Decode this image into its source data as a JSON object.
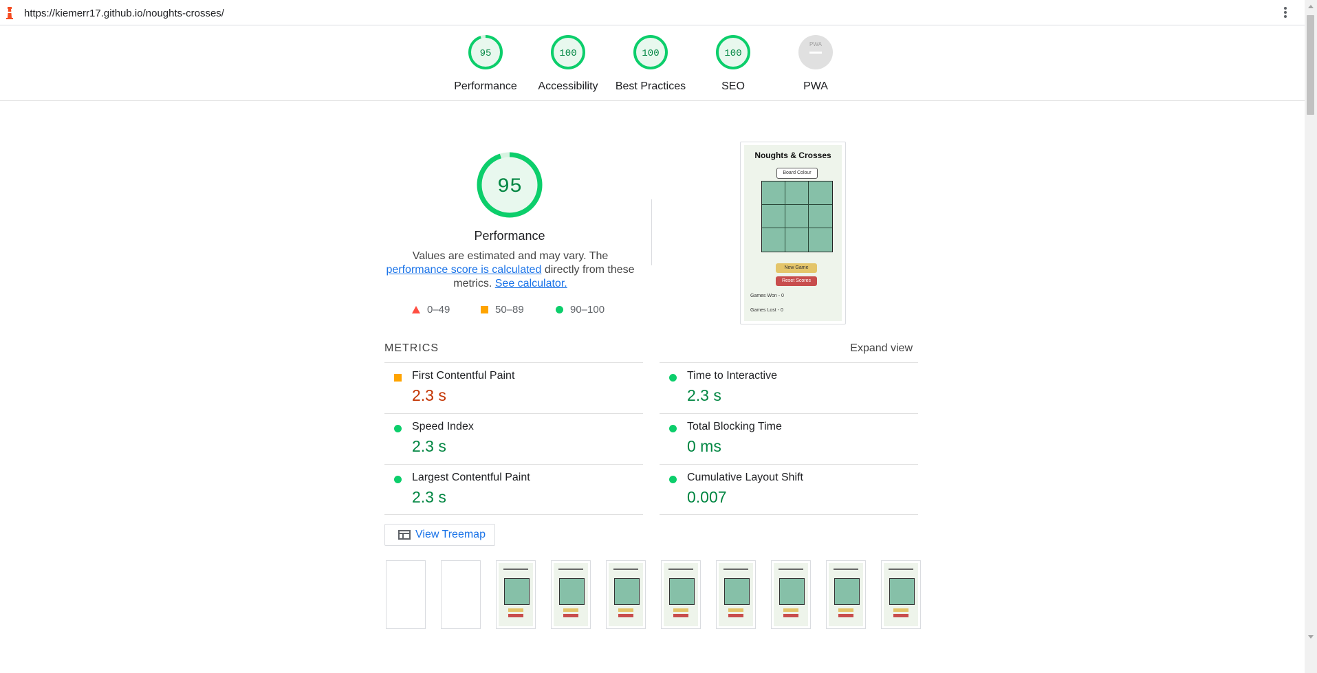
{
  "browser": {
    "url": "https://kiemerr17.github.io/noughts-crosses/"
  },
  "score_categories": [
    {
      "label": "Performance",
      "score": "95",
      "color": "#0cce6b"
    },
    {
      "label": "Accessibility",
      "score": "100",
      "color": "#0cce6b"
    },
    {
      "label": "Best Practices",
      "score": "100",
      "color": "#0cce6b"
    },
    {
      "label": "SEO",
      "score": "100",
      "color": "#0cce6b"
    },
    {
      "label": "PWA",
      "score": "",
      "badge_text": "PWA",
      "color": "#9e9e9e"
    }
  ],
  "performance": {
    "score": "95",
    "score_fraction": 0.95,
    "title": "Performance",
    "desc_1": "Values are estimated and may vary. The",
    "desc_link_1": "performance score is calculated",
    "desc_2": "directly from these metrics.",
    "desc_link_2": "See calculator."
  },
  "legend": [
    {
      "label": "0–49",
      "shape": "triangle",
      "color": "#ff4e42"
    },
    {
      "label": "50–89",
      "shape": "square",
      "color": "#ffa400"
    },
    {
      "label": "90–100",
      "shape": "circle",
      "color": "#0cce6b"
    }
  ],
  "app_preview": {
    "title": "Noughts & Crosses",
    "board_colour_button": "Board Colour",
    "new_game_button": "New Game",
    "reset_scores_button": "Reset Scores",
    "games_won": "Games Won - 0",
    "games_lost": "Games Lost - 0"
  },
  "metrics_section": {
    "header": "METRICS",
    "expand_label": "Expand view",
    "items": [
      {
        "name": "First Contentful Paint",
        "value": "2.3 s",
        "rating": "average",
        "color": "#c33300"
      },
      {
        "name": "Time to Interactive",
        "value": "2.3 s",
        "rating": "pass",
        "color": "#018642"
      },
      {
        "name": "Speed Index",
        "value": "2.3 s",
        "rating": "pass",
        "color": "#018642"
      },
      {
        "name": "Total Blocking Time",
        "value": "0 ms",
        "rating": "pass",
        "color": "#018642"
      },
      {
        "name": "Largest Contentful Paint",
        "value": "2.3 s",
        "rating": "pass",
        "color": "#018642"
      },
      {
        "name": "Cumulative Layout Shift",
        "value": "0.007",
        "rating": "pass",
        "color": "#018642"
      }
    ]
  },
  "treemap_button": "View Treemap",
  "filmstrip": {
    "frames": [
      {
        "loaded": false
      },
      {
        "loaded": false
      },
      {
        "loaded": true
      },
      {
        "loaded": true
      },
      {
        "loaded": true
      },
      {
        "loaded": true
      },
      {
        "loaded": true
      },
      {
        "loaded": true
      },
      {
        "loaded": true
      },
      {
        "loaded": true
      }
    ]
  },
  "colors": {
    "pass": "#0cce6b",
    "average": "#ffa400",
    "fail": "#ff4e42",
    "link": "#1a73e8",
    "board": "#86c0a8"
  }
}
